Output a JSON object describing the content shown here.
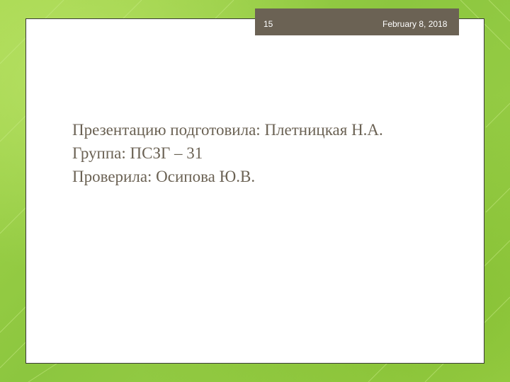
{
  "header": {
    "slide_number": "15",
    "date": "February 8, 2018"
  },
  "content": {
    "lines": [
      "Презентацию подготовила: Плетницкая Н.А.",
      "Группа: ПСЗГ – 31",
      "Проверила: Осипова Ю.В."
    ]
  },
  "colors": {
    "background_green": "#8fc93a",
    "header_box": "#6b6254",
    "text": "#6b6254",
    "slide": "#ffffff"
  }
}
